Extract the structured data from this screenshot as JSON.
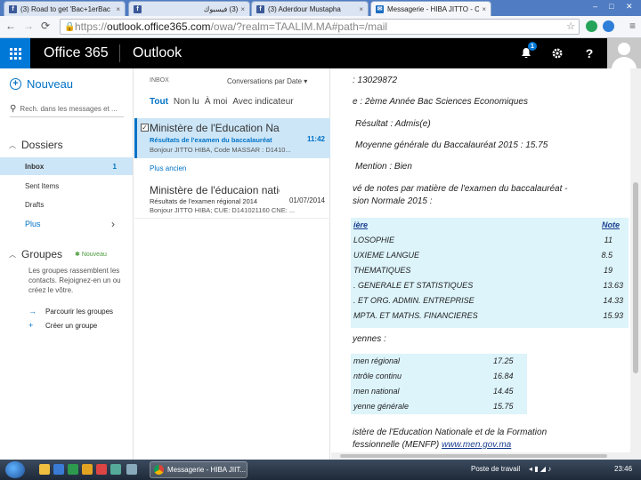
{
  "browser": {
    "tabs": [
      {
        "title": "(3) Road to get 'Bac+1erBac",
        "favicon": "facebook-icon",
        "close": "×"
      },
      {
        "title": "(3) فيسبوك",
        "favicon": "facebook-icon",
        "close": "×"
      },
      {
        "title": "(3) Aderdour Mustapha",
        "favicon": "facebook-icon",
        "close": "×"
      },
      {
        "title": "Messagerie - HIBA JITTO - C",
        "favicon": "mail-icon",
        "close": "×"
      }
    ],
    "window_controls": {
      "minimize": "–",
      "maximize": "□",
      "close": "✕"
    },
    "url_scheme": "https://",
    "url_host": "outlook.office365.com",
    "url_path": "/owa/?realm=TAALIM.MA#path=/mail"
  },
  "header": {
    "brand": "Office 365",
    "app": "Outlook",
    "notification_count": "1",
    "help": "?"
  },
  "nav": {
    "new_label": "Nouveau",
    "search_placeholder": "Rech. dans les messages et ...",
    "folders_heading": "Dossiers",
    "folders": [
      {
        "label": "Inbox",
        "count": "1"
      },
      {
        "label": "Sent Items",
        "count": ""
      },
      {
        "label": "Drafts",
        "count": ""
      }
    ],
    "more_label": "Plus",
    "groups_heading": "Groupes",
    "groups_new": "Nouveau",
    "groups_desc": "Les groupes rassemblent les contacts. Rejoignez-en un ou créez le vôtre.",
    "browse_groups": "Parcourir les groupes",
    "create_group": "Créer un groupe"
  },
  "list": {
    "folder_name": "INBOX",
    "sort_label": "Conversations par Date",
    "filters": [
      "Tout",
      "Non lu",
      "À moi",
      "Avec indicateur"
    ],
    "older_label": "Plus ancien",
    "messages": [
      {
        "from": "Ministère de l'Education Nationale",
        "subject": "Résultats de l'examen du baccalauréat",
        "preview": "Bonjour JITTO HIBA, Code MASSAR : D1410...",
        "time": "11:42"
      },
      {
        "from": "Ministère de l'éducaion nationale",
        "subject": "Résultats de l'examen régional 2014",
        "preview": "Bonjour JITTO HIBA;  CUE: D141021160 CNE: ...",
        "time": "01/07/2014"
      }
    ]
  },
  "reading": {
    "line_code": ": 13029872",
    "line_filiere": "e : 2ème Année Bac Sciences Economiques",
    "line_resultat": "Résultat : Admis(e)",
    "line_moyenne": "Moyenne générale du Baccalauréat 2015 : 15.75",
    "line_mention": "Mention : Bien",
    "line_releve_1": "vé de notes par matière de l'examen du baccalauréat -",
    "line_releve_2": "sion Normale 2015 :",
    "grades_header": {
      "subject": "ière",
      "note": "Note"
    },
    "grades": [
      {
        "subject": "LOSOPHIE",
        "note": "11"
      },
      {
        "subject": "UXIEME LANGUE",
        "note": "8.5"
      },
      {
        "subject": "THEMATIQUES",
        "note": "19"
      },
      {
        "subject": ". GENERALE ET STATISTIQUES",
        "note": "13.63"
      },
      {
        "subject": ". ET ORG. ADMIN. ENTREPRISE",
        "note": "14.33"
      },
      {
        "subject": "MPTA. ET MATHS. FINANCIERES",
        "note": "15.93"
      }
    ],
    "averages_heading": "yennes :",
    "averages": [
      {
        "label": "men régional",
        "value": "17.25"
      },
      {
        "label": "ntrôle continu",
        "value": "16.84"
      },
      {
        "label": "men national",
        "value": "14.45"
      },
      {
        "label": "yenne générale",
        "value": "15.75"
      }
    ],
    "footer_1": "istère de l'Education Nationale et de la Formation",
    "footer_2_prefix": "fessionnelle (MENFP) ",
    "footer_link": "www.men.gov.ma"
  },
  "taskbar": {
    "task_label": "Messagerie - HIBA JIIT...",
    "tray_label": "Poste de travail",
    "clock": "23:46"
  }
}
